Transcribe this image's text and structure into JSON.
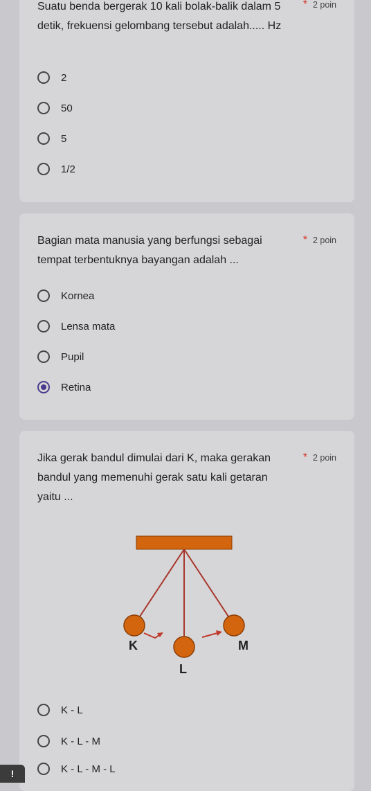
{
  "questions": [
    {
      "text": "Suatu benda bergerak 10 kali bolak-balik dalam 5 detik, frekuensi gelombang tersebut adalah..... Hz",
      "points": "2 poin",
      "options": [
        "2",
        "50",
        "5",
        "1/2"
      ],
      "selected": null
    },
    {
      "text": "Bagian mata manusia yang berfungsi sebagai tempat terbentuknya bayangan adalah ...",
      "points": "2 poin",
      "options": [
        "Kornea",
        "Lensa mata",
        "Pupil",
        "Retina"
      ],
      "selected": 3
    },
    {
      "text": "Jika gerak bandul dimulai dari K, maka gerakan bandul yang memenuhi gerak satu kali getaran yaitu ...",
      "points": "2 poin",
      "figure": {
        "labels": [
          "K",
          "L",
          "M"
        ]
      },
      "options": [
        "K - L",
        "K - L - M",
        "K - L - M - L"
      ],
      "selected": null
    }
  ],
  "required_marker": "*",
  "warning_badge": "!",
  "colors": {
    "page_bg": "#c9c8cd",
    "card_bg": "#d6d6d8",
    "required_star": "#d93025",
    "radio_selected": "#4a3a8c",
    "pendulum_orange": "#d3650e",
    "string_red": "#a7352a",
    "arrow_red": "#c0392b"
  }
}
